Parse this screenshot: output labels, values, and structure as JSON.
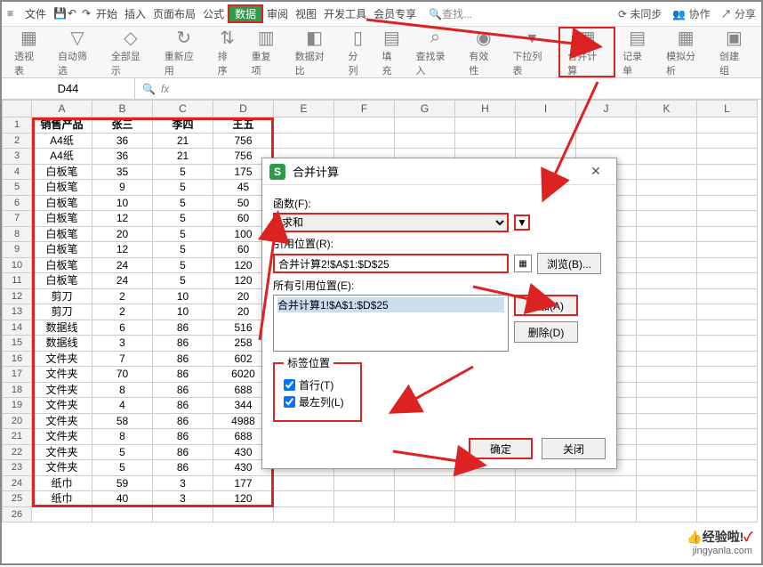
{
  "menubar": {
    "file": "文件",
    "tabs": [
      "开始",
      "插入",
      "页面布局",
      "公式",
      "数据",
      "审阅",
      "视图",
      "开发工具",
      "会员专享"
    ],
    "activeIndex": 4,
    "search_placeholder": "查找...",
    "sync": "未同步",
    "coop": "协作",
    "share": "分享"
  },
  "toolbar": {
    "items": [
      {
        "label": "透视表",
        "glyph": "▦"
      },
      {
        "label": "自动筛选",
        "glyph": "▽"
      },
      {
        "label": "全部显示",
        "glyph": "◇"
      },
      {
        "label": "重新应用",
        "glyph": "↻"
      },
      {
        "label": "排序",
        "glyph": "⇅"
      },
      {
        "label": "重复项",
        "glyph": "▥"
      },
      {
        "label": "数据对比",
        "glyph": "◧"
      },
      {
        "label": "分列",
        "glyph": "▯"
      },
      {
        "label": "填充",
        "glyph": "▤"
      },
      {
        "label": "查找录入",
        "glyph": "⌕"
      },
      {
        "label": "有效性",
        "glyph": "◉"
      },
      {
        "label": "下拉列表",
        "glyph": "▾"
      },
      {
        "label": "合并计算",
        "glyph": "▦",
        "hl": true
      },
      {
        "label": "记录单",
        "glyph": "▤"
      },
      {
        "label": "模拟分析",
        "glyph": "▦"
      },
      {
        "label": "创建组",
        "glyph": "▣"
      }
    ]
  },
  "namebox": "D44",
  "columns": [
    "A",
    "B",
    "C",
    "D",
    "E",
    "F",
    "G",
    "H",
    "I",
    "J",
    "K",
    "L"
  ],
  "table": {
    "header": [
      "销售产品",
      "张三",
      "李四",
      "王五"
    ],
    "rows": [
      [
        "A4纸",
        "36",
        "21",
        "756"
      ],
      [
        "A4纸",
        "36",
        "21",
        "756"
      ],
      [
        "白板笔",
        "35",
        "5",
        "175"
      ],
      [
        "白板笔",
        "9",
        "5",
        "45"
      ],
      [
        "白板笔",
        "10",
        "5",
        "50"
      ],
      [
        "白板笔",
        "12",
        "5",
        "60"
      ],
      [
        "白板笔",
        "20",
        "5",
        "100"
      ],
      [
        "白板笔",
        "12",
        "5",
        "60"
      ],
      [
        "白板笔",
        "24",
        "5",
        "120"
      ],
      [
        "白板笔",
        "24",
        "5",
        "120"
      ],
      [
        "剪刀",
        "2",
        "10",
        "20"
      ],
      [
        "剪刀",
        "2",
        "10",
        "20"
      ],
      [
        "数据线",
        "6",
        "86",
        "516"
      ],
      [
        "数据线",
        "3",
        "86",
        "258"
      ],
      [
        "文件夹",
        "7",
        "86",
        "602"
      ],
      [
        "文件夹",
        "70",
        "86",
        "6020"
      ],
      [
        "文件夹",
        "8",
        "86",
        "688"
      ],
      [
        "文件夹",
        "4",
        "86",
        "344"
      ],
      [
        "文件夹",
        "58",
        "86",
        "4988"
      ],
      [
        "文件夹",
        "8",
        "86",
        "688"
      ],
      [
        "文件夹",
        "5",
        "86",
        "430"
      ],
      [
        "文件夹",
        "5",
        "86",
        "430"
      ],
      [
        "纸巾",
        "59",
        "3",
        "177"
      ],
      [
        "纸巾",
        "40",
        "3",
        "120"
      ]
    ]
  },
  "dialog": {
    "title": "合并计算",
    "func_label": "函数(F):",
    "func_value": "求和",
    "ref_label": "引用位置(R):",
    "ref_value": "合并计算2!$A$1:$D$25",
    "allrefs_label": "所有引用位置(E):",
    "allrefs_items": [
      "合并计算1!$A$1:$D$25"
    ],
    "browse": "浏览(B)...",
    "add": "添加(A)",
    "delete": "删除(D)",
    "labelpos_legend": "标签位置",
    "toprow": "首行(T)",
    "leftcol": "最左列(L)",
    "ok": "确定",
    "close": "关闭"
  },
  "watermark": {
    "main": "经验啦!",
    "sub": "jingyanla.com"
  }
}
